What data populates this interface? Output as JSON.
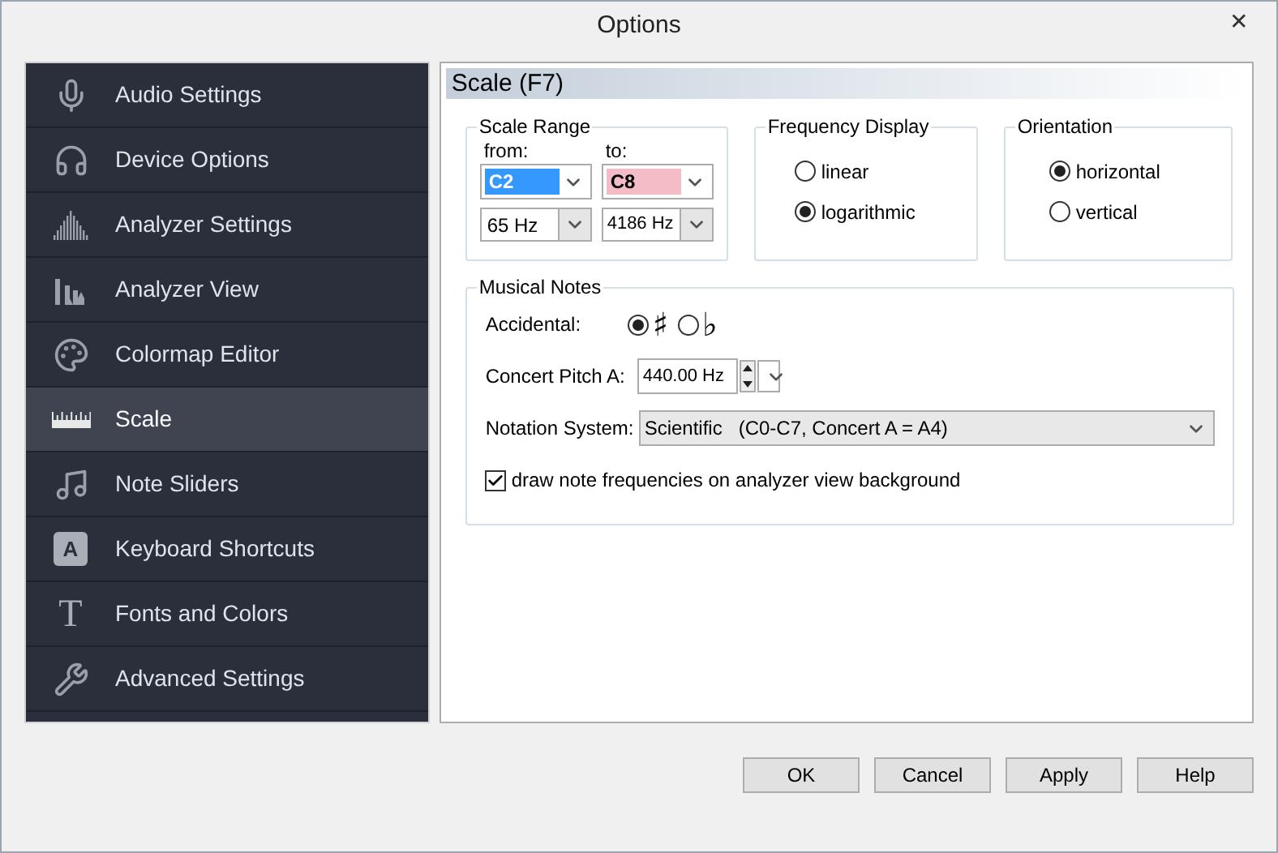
{
  "window": {
    "title": "Options",
    "close": "✕"
  },
  "sidebar": {
    "items": [
      {
        "label": "Audio Settings",
        "selected": false
      },
      {
        "label": "Device Options",
        "selected": false
      },
      {
        "label": "Analyzer Settings",
        "selected": false
      },
      {
        "label": "Analyzer View",
        "selected": false
      },
      {
        "label": "Colormap Editor",
        "selected": false
      },
      {
        "label": "Scale",
        "selected": true
      },
      {
        "label": "Note Sliders",
        "selected": false
      },
      {
        "label": "Keyboard Shortcuts",
        "selected": false,
        "icon_letter": "A"
      },
      {
        "label": "Fonts and Colors",
        "selected": false,
        "icon_letter": "T"
      },
      {
        "label": "Advanced Settings",
        "selected": false
      }
    ]
  },
  "page": {
    "title": "Scale (F7)",
    "scale_range": {
      "title": "Scale Range",
      "from_label": "from:",
      "to_label": "to:",
      "from_note": "C2",
      "to_note": "C8",
      "from_freq": "65 Hz",
      "to_freq": "4186 Hz"
    },
    "frequency_display": {
      "title": "Frequency Display",
      "options": [
        {
          "label": "linear",
          "selected": false
        },
        {
          "label": "logarithmic",
          "selected": true
        }
      ]
    },
    "orientation": {
      "title": "Orientation",
      "options": [
        {
          "label": "horizontal",
          "selected": true
        },
        {
          "label": "vertical",
          "selected": false
        }
      ]
    },
    "musical_notes": {
      "title": "Musical Notes",
      "accidental_label": "Accidental:",
      "accidentals": [
        {
          "symbol": "♯",
          "selected": true
        },
        {
          "symbol": "♭",
          "selected": false
        }
      ],
      "concert_pitch_label": "Concert Pitch A:",
      "concert_pitch": "440.00 Hz",
      "notation_label": "Notation System:",
      "notation_name": "Scientific",
      "notation_detail": "(C0-C7, Concert A = A4)",
      "draw_frequencies": {
        "label": "draw note frequencies on analyzer view background",
        "checked": true
      }
    }
  },
  "buttons": [
    "OK",
    "Cancel",
    "Apply",
    "Help"
  ]
}
